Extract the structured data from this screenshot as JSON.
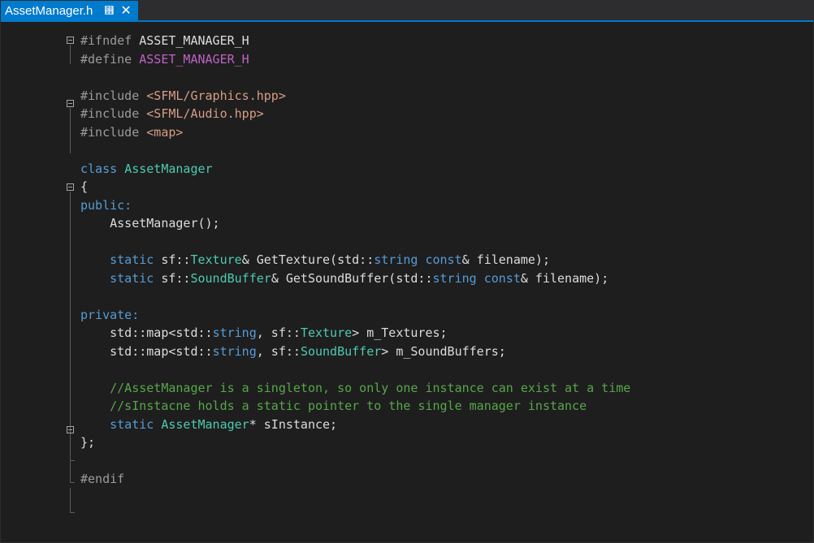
{
  "tab": {
    "title": "AssetManager.h",
    "pin_icon": "pin-icon",
    "close_icon": "close-icon"
  },
  "colors": {
    "editor_bg": "#1e1e1e",
    "tab_active": "#007acc",
    "keyword": "#569cd6",
    "preprocessor": "#9b9b9b",
    "macro": "#bd63c5",
    "string": "#d69d85",
    "type": "#4ec9b0",
    "comment": "#57a64a"
  },
  "code": {
    "l1": {
      "a": "#ifndef ",
      "b": "ASSET_MANAGER_H"
    },
    "l2": {
      "a": "#define ",
      "b": "ASSET_MANAGER_H"
    },
    "l4": {
      "a": "#include ",
      "b": "<SFML/Graphics.hpp>"
    },
    "l5": {
      "a": "#include ",
      "b": "<SFML/Audio.hpp>"
    },
    "l6": {
      "a": "#include ",
      "b": "<map>"
    },
    "l8": {
      "a": "class ",
      "b": "AssetManager"
    },
    "l9": {
      "a": "{"
    },
    "l10": {
      "a": "public:"
    },
    "l11": {
      "a": "    AssetManager();"
    },
    "l13": {
      "a": "    ",
      "b": "static",
      "c": " sf::",
      "d": "Texture",
      "e": "& GetTexture(std::",
      "f": "string",
      "g": " ",
      "h": "const",
      "i": "& filename);"
    },
    "l14": {
      "a": "    ",
      "b": "static",
      "c": " sf::",
      "d": "SoundBuffer",
      "e": "& GetSoundBuffer(std::",
      "f": "string",
      "g": " ",
      "h": "const",
      "i": "& filename);"
    },
    "l16": {
      "a": "private:"
    },
    "l17": {
      "a": "    std::map<std::",
      "b": "string",
      "c": ", sf::",
      "d": "Texture",
      "e": "> m_Textures;"
    },
    "l18": {
      "a": "    std::map<std::",
      "b": "string",
      "c": ", sf::",
      "d": "SoundBuffer",
      "e": "> m_SoundBuffers;"
    },
    "l20": {
      "a": "    //AssetManager is a singleton, so only one instance can exist at a time"
    },
    "l21": {
      "a": "    //sInstacne holds a static pointer to the single manager instance"
    },
    "l22": {
      "a": "    ",
      "b": "static",
      "c": " ",
      "d": "AssetManager",
      "e": "* sInstance;"
    },
    "l23": {
      "a": "};"
    },
    "l25": {
      "a": "#endif"
    }
  }
}
